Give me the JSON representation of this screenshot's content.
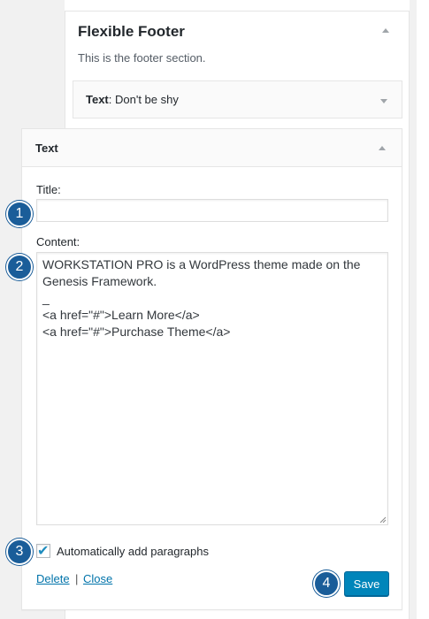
{
  "widget_area": {
    "title": "Flexible Footer",
    "description": "This is the footer section."
  },
  "collapsed_widget": {
    "type_label": "Text",
    "sep": ":",
    "instance_title": " Don't be shy"
  },
  "open_widget": {
    "type_label": "Text",
    "title_label": "Title:",
    "title_value": "",
    "content_label": "Content:",
    "content_value": "WORKSTATION PRO is a WordPress theme made on the Genesis Framework.\n_\n<a href=\"#\">Learn More</a>\n<a href=\"#\">Purchase Theme</a>",
    "autop_label": "Automatically add paragraphs",
    "autop_checked": true,
    "delete_label": "Delete",
    "link_sep": "|",
    "close_label": "Close",
    "save_label": "Save"
  },
  "badges": [
    "1",
    "2",
    "3",
    "4"
  ],
  "colors": {
    "badge": "#1a5d99",
    "primary_button": "#0085ba",
    "link": "#0073aa"
  }
}
